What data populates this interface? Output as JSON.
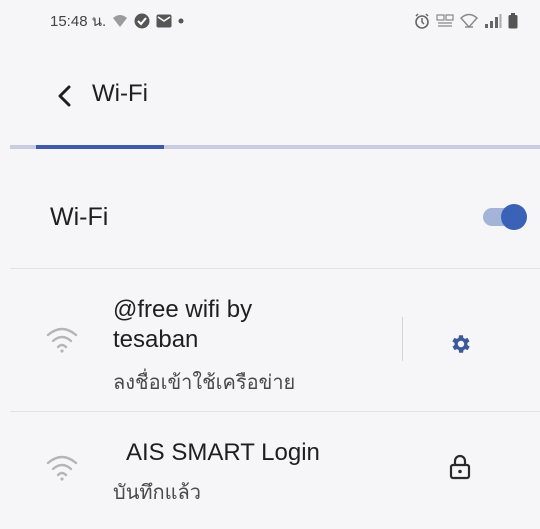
{
  "status_bar": {
    "time": "15:48 น.",
    "left_icons": [
      "wifi-signal-icon",
      "data-saver-icon",
      "mail-icon",
      "notification-dot-icon"
    ],
    "right_icons": [
      "alarm-icon",
      "5g-icon",
      "wifi-calling-icon",
      "cell-signal-icon",
      "battery-icon"
    ]
  },
  "app_bar": {
    "back_icon": "back-arrow-icon",
    "title": "Wi-Fi"
  },
  "wifi_toggle": {
    "label": "Wi-Fi",
    "enabled": true
  },
  "networks": [
    {
      "name_line1": "@free wifi by",
      "name_line2": "tesaban",
      "status": "ลงชื่อเข้าใช้เครือข่าย",
      "icon": "wifi-icon",
      "action_icon": "settings-gear-icon"
    },
    {
      "name": "AIS SMART Login",
      "status": "บันทึกแล้ว",
      "icon": "wifi-icon",
      "action_icon": "lock-icon"
    }
  ],
  "colors": {
    "accent": "#3a63b8",
    "tab_indicator": "#3f5aa8",
    "background": "#f6f6f8"
  }
}
